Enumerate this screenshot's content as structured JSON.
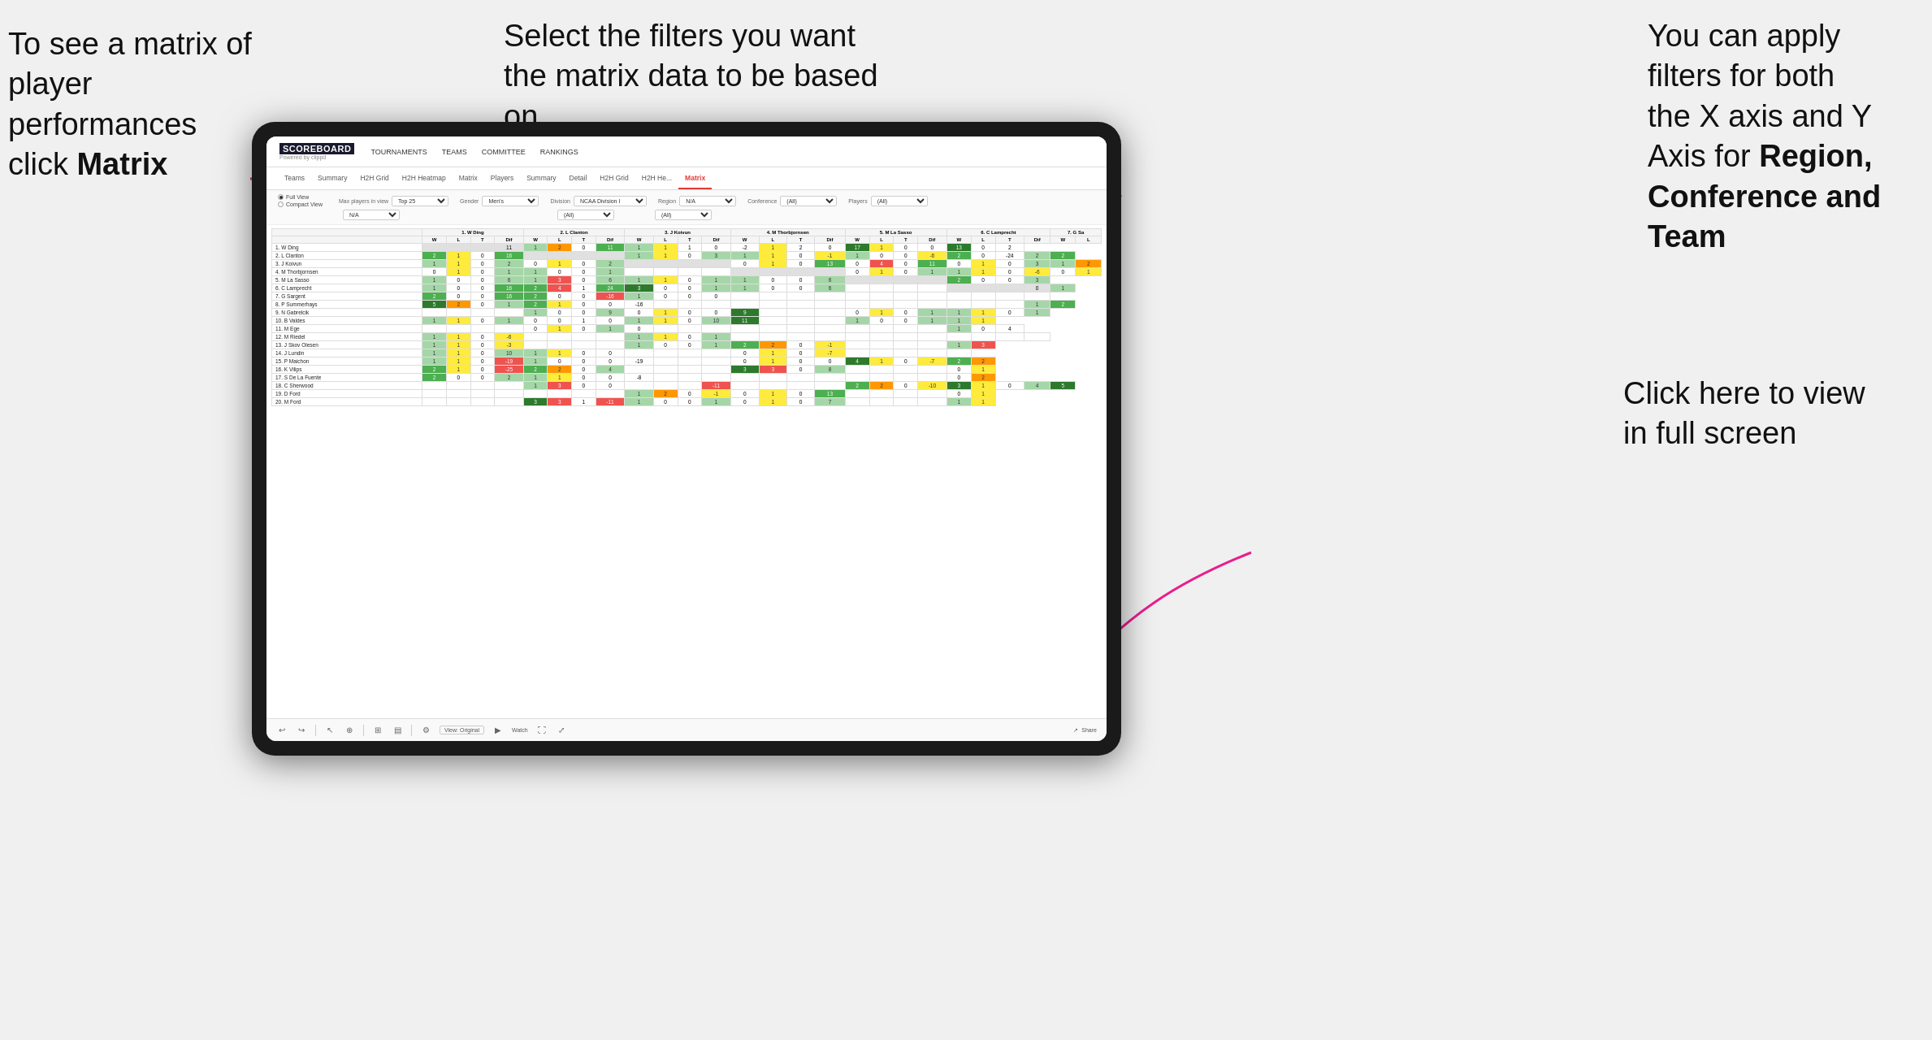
{
  "annotations": {
    "left": {
      "line1": "To see a matrix of",
      "line2": "player performances",
      "line3_prefix": "click ",
      "line3_bold": "Matrix"
    },
    "center": {
      "text": "Select the filters you want the matrix data to be based on"
    },
    "right": {
      "line1": "You  can apply",
      "line2": "filters for both",
      "line3": "the X axis and Y",
      "line4_prefix": "Axis for ",
      "line4_bold": "Region,",
      "line5_bold": "Conference and",
      "line6_bold": "Team"
    },
    "bottom_right": {
      "line1": "Click here to view",
      "line2": "in full screen"
    }
  },
  "nav": {
    "logo_title": "SCOREBOARD",
    "logo_sub": "Powered by clippd",
    "items": [
      "TOURNAMENTS",
      "TEAMS",
      "COMMITTEE",
      "RANKINGS"
    ]
  },
  "tabs": {
    "players_group": [
      "Teams",
      "Summary",
      "H2H Grid",
      "H2H Heatmap",
      "Matrix",
      "Players",
      "Summary",
      "Detail",
      "H2H Grid",
      "H2H He...",
      "Matrix"
    ],
    "active": "Matrix"
  },
  "filters": {
    "view_options": [
      "Full View",
      "Compact View"
    ],
    "active_view": "Full View",
    "max_players_label": "Max players in view",
    "max_players_value": "Top 25",
    "gender_label": "Gender",
    "gender_value": "Men's",
    "division_label": "Division",
    "division_value": "NCAA Division I",
    "region_label": "Region",
    "region_value": "N/A",
    "conference_label": "Conference",
    "conference_value": "(All)",
    "conference_value2": "(All)",
    "players_label": "Players",
    "players_value": "(All)",
    "players_value2": "(All)"
  },
  "matrix": {
    "col_headers": [
      "1. W Ding",
      "2. L Clanton",
      "3. J Koivun",
      "4. M Thorbjornsen",
      "5. M La Sasso",
      "6. C Lamprecht",
      "7. G Sa"
    ],
    "sub_headers": [
      "W",
      "L",
      "T",
      "Dif"
    ],
    "rows": [
      {
        "name": "1. W Ding",
        "cells": [
          "",
          "",
          "",
          "11",
          "1",
          "2",
          "0",
          "11",
          "1",
          "1",
          "1",
          "0",
          "-2",
          "1",
          "2",
          "0",
          "17",
          "1",
          "0",
          "0",
          "13",
          "0",
          "2"
        ]
      },
      {
        "name": "2. L Clanton",
        "cells": [
          "2",
          "1",
          "0",
          "16",
          "",
          "",
          "",
          "",
          "1",
          "1",
          "0",
          "3",
          "1",
          "1",
          "0",
          "-1",
          "1",
          "0",
          "0",
          "-6",
          "2",
          "0",
          "-24",
          "2",
          "2"
        ]
      },
      {
        "name": "3. J Koivun",
        "cells": [
          "1",
          "1",
          "0",
          "2",
          "0",
          "1",
          "0",
          "2",
          "",
          "",
          "",
          "",
          "0",
          "1",
          "0",
          "13",
          "0",
          "4",
          "0",
          "11",
          "0",
          "1",
          "0",
          "3",
          "1",
          "2"
        ]
      },
      {
        "name": "4. M Thorbjornsen",
        "cells": [
          "0",
          "1",
          "0",
          "1",
          "1",
          "0",
          "0",
          "1",
          "",
          "",
          "",
          "",
          "",
          "",
          "",
          "",
          "0",
          "1",
          "0",
          "1",
          "1",
          "1",
          "0",
          "-6",
          "0",
          "1"
        ]
      },
      {
        "name": "5. M La Sasso",
        "cells": [
          "1",
          "0",
          "0",
          "6",
          "1",
          "3",
          "0",
          "6",
          "1",
          "1",
          "0",
          "1",
          "1",
          "0",
          "0",
          "6",
          "",
          "",
          "",
          "",
          "2",
          "0",
          "0",
          "3"
        ]
      },
      {
        "name": "6. C Lamprecht",
        "cells": [
          "1",
          "0",
          "0",
          "16",
          "2",
          "4",
          "1",
          "24",
          "3",
          "0",
          "0",
          "1",
          "1",
          "0",
          "0",
          "6",
          "",
          "",
          "",
          "",
          "",
          "",
          "",
          "0",
          "1"
        ]
      },
      {
        "name": "7. G Sargent",
        "cells": [
          "2",
          "0",
          "0",
          "16",
          "2",
          "0",
          "0",
          "-16",
          "1",
          "0",
          "0",
          "0",
          "",
          "",
          "",
          "",
          "",
          "",
          "",
          "",
          "",
          "",
          "",
          ""
        ]
      },
      {
        "name": "8. P Summerhays",
        "cells": [
          "5",
          "2",
          "0",
          "1",
          "2",
          "1",
          "0",
          "0",
          "-16",
          "",
          "",
          "",
          "",
          "",
          "",
          "",
          "",
          "",
          "",
          "",
          "",
          "",
          "",
          "1",
          "2"
        ]
      },
      {
        "name": "9. N Gabrelcik",
        "cells": [
          "",
          "",
          "",
          "",
          "1",
          "0",
          "0",
          "9",
          "0",
          "1",
          "0",
          "0",
          "9",
          "",
          "",
          "",
          "0",
          "1",
          "0",
          "1",
          "1",
          "1",
          "0",
          "1"
        ]
      },
      {
        "name": "10. B Valdes",
        "cells": [
          "1",
          "1",
          "0",
          "1",
          "0",
          "0",
          "1",
          "0",
          "1",
          "1",
          "0",
          "10",
          "11",
          "",
          "",
          "",
          "1",
          "0",
          "0",
          "1",
          "1",
          "1"
        ]
      },
      {
        "name": "11. M Ege",
        "cells": [
          "",
          "",
          "",
          "",
          "0",
          "1",
          "0",
          "1",
          "0",
          "",
          "",
          "",
          "",
          "",
          "",
          "",
          "",
          "",
          "",
          "",
          "1",
          "0",
          "4"
        ]
      },
      {
        "name": "12. M Riedel",
        "cells": [
          "1",
          "1",
          "0",
          "-6",
          "",
          "",
          "",
          "",
          "1",
          "1",
          "0",
          "1",
          "",
          "",
          "",
          "",
          "",
          "",
          "",
          "",
          "",
          "",
          "",
          ""
        ]
      },
      {
        "name": "13. J Skov Olesen",
        "cells": [
          "1",
          "1",
          "0",
          "-3",
          "",
          "",
          "",
          "",
          "1",
          "0",
          "0",
          "1",
          "2",
          "2",
          "0",
          "-1",
          "",
          "",
          "",
          "",
          "1",
          "3"
        ]
      },
      {
        "name": "14. J Lundin",
        "cells": [
          "1",
          "1",
          "0",
          "10",
          "1",
          "1",
          "0",
          "0",
          "",
          "",
          "",
          "",
          "0",
          "1",
          "0",
          "-7",
          "",
          "",
          "",
          "",
          ""
        ]
      },
      {
        "name": "15. P Maichon",
        "cells": [
          "1",
          "1",
          "0",
          "-19",
          "1",
          "0",
          "0",
          "0",
          "-19",
          "",
          "",
          "",
          "0",
          "1",
          "0",
          "0",
          "4",
          "1",
          "0",
          "-7",
          "2",
          "2"
        ]
      },
      {
        "name": "16. K Vilips",
        "cells": [
          "2",
          "1",
          "0",
          "-25",
          "2",
          "2",
          "0",
          "4",
          "",
          "",
          "",
          "",
          "3",
          "3",
          "0",
          "8",
          "",
          "",
          "",
          "",
          "0",
          "1"
        ]
      },
      {
        "name": "17. S De La Fuente",
        "cells": [
          "2",
          "0",
          "0",
          "2",
          "1",
          "1",
          "0",
          "0",
          "-8",
          "",
          "",
          "",
          "",
          "",
          "",
          "",
          "",
          "",
          "",
          "",
          "0",
          "2"
        ]
      },
      {
        "name": "18. C Sherwood",
        "cells": [
          "",
          "",
          "",
          "",
          "1",
          "3",
          "0",
          "0",
          "",
          "",
          "",
          "-11",
          "",
          "",
          "",
          "",
          "2",
          "2",
          "0",
          "-10",
          "3",
          "1",
          "0",
          "4",
          "5"
        ]
      },
      {
        "name": "19. D Ford",
        "cells": [
          "",
          "",
          "",
          "",
          "",
          "",
          "",
          "",
          "1",
          "2",
          "0",
          "-1",
          "0",
          "1",
          "0",
          "13",
          "",
          "",
          "",
          "",
          "0",
          "1"
        ]
      },
      {
        "name": "20. M Ford",
        "cells": [
          "",
          "",
          "",
          "",
          "3",
          "3",
          "1",
          "-11",
          "1",
          "0",
          "0",
          "1",
          "0",
          "1",
          "0",
          "7",
          "",
          "",
          "",
          "",
          "1",
          "1"
        ]
      }
    ]
  },
  "toolbar": {
    "view_label": "View: Original",
    "watch_label": "Watch",
    "share_label": "Share"
  }
}
